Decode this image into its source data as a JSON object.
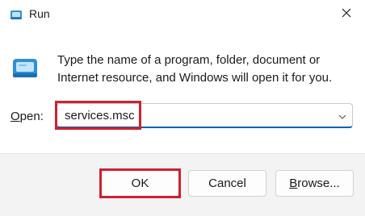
{
  "window": {
    "title": "Run",
    "title_icon": "run-app-icon",
    "close_icon": "close-icon"
  },
  "body": {
    "icon": "run-app-icon",
    "description": "Type the name of a program, folder, document or Internet resource, and Windows will open it for you."
  },
  "open_field": {
    "label_access_key": "O",
    "label_rest": "pen:",
    "value": "services.msc",
    "dropdown_icon": "chevron-down-icon"
  },
  "buttons": {
    "ok": "OK",
    "cancel": "Cancel",
    "browse_access_key": "B",
    "browse_rest": "rowse..."
  },
  "highlights": {
    "color": "#d0202e"
  },
  "colors": {
    "accent": "#005fb8",
    "footer_bg": "#f3f3f3"
  }
}
